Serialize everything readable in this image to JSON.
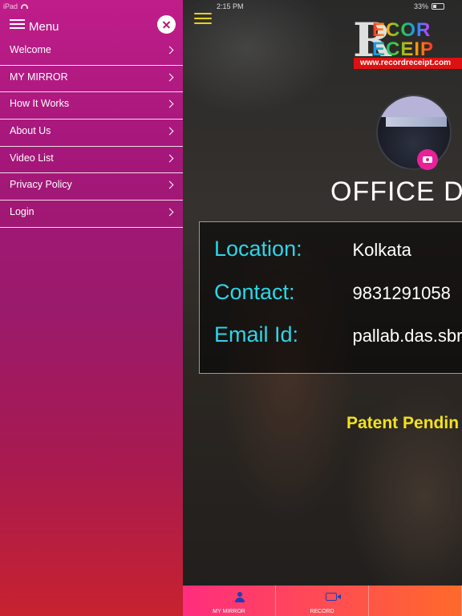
{
  "status_bar": {
    "device": "iPad",
    "time": "2:15 PM",
    "battery": "33%"
  },
  "menu": {
    "title": "Menu",
    "items": [
      {
        "label": "Welcome"
      },
      {
        "label": "MY MIRROR"
      },
      {
        "label": "How It Works"
      },
      {
        "label": "About Us"
      },
      {
        "label": "Video List"
      },
      {
        "label": "Privacy Policy"
      },
      {
        "label": "Login"
      }
    ]
  },
  "logo": {
    "line1": "ECOR",
    "line2": "ECEIP",
    "url": "www.recordreceipt.com"
  },
  "profile": {
    "company_name": "OFFICE DA",
    "location_label": "Location:",
    "location_value": "Kolkata",
    "contact_label": "Contact:",
    "contact_value": "9831291058",
    "email_label": "Email Id:",
    "email_value": "pallab.das.sbr"
  },
  "patent_text": "Patent Pendin",
  "tabbar": {
    "tabs": [
      {
        "label": "MY MIRROR",
        "icon": "user-icon"
      },
      {
        "label": "RECORD",
        "icon": "video-camera-icon"
      }
    ]
  },
  "colors": {
    "accent_cyan": "#2cd6e8",
    "patent_yellow": "#f1e21e",
    "menu_pink": "#c01d8a",
    "camera_pink": "#e8219a"
  }
}
